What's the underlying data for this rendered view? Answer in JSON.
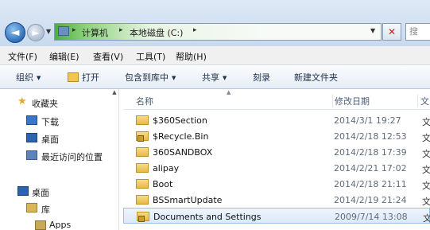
{
  "address": {
    "crumbs": [
      "计算机",
      "本地磁盘 (C:)"
    ],
    "search_placeholder": "搜"
  },
  "menu": [
    "文件(F)",
    "编辑(E)",
    "查看(V)",
    "工具(T)",
    "帮助(H)"
  ],
  "toolbar": {
    "organize": "组织",
    "open": "打开",
    "include_in_library": "包含到库中",
    "share": "共享",
    "burn": "刻录",
    "new_folder": "新建文件夹"
  },
  "nav": {
    "favorites": "收藏夹",
    "downloads": "下载",
    "desktop": "桌面",
    "recent": "最近访问的位置",
    "desktop_root": "桌面",
    "libraries": "库",
    "apps": "Apps"
  },
  "columns": {
    "name": "名称",
    "date": "修改日期",
    "type": "文"
  },
  "files": [
    {
      "name": "$360Section",
      "date": "2014/3/1 19:27",
      "type": "文"
    },
    {
      "name": "$Recycle.Bin",
      "date": "2014/2/18 12:53",
      "type": "文"
    },
    {
      "name": "360SANDBOX",
      "date": "2014/2/18 17:39",
      "type": "文"
    },
    {
      "name": "alipay",
      "date": "2014/2/21 17:02",
      "type": "文"
    },
    {
      "name": "Boot",
      "date": "2014/2/18 21:11",
      "type": "文"
    },
    {
      "name": "BSSmartUpdate",
      "date": "2014/2/19 21:24",
      "type": "文"
    },
    {
      "name": "Documents and Settings",
      "date": "2009/7/14 13:08",
      "type": "文"
    }
  ]
}
